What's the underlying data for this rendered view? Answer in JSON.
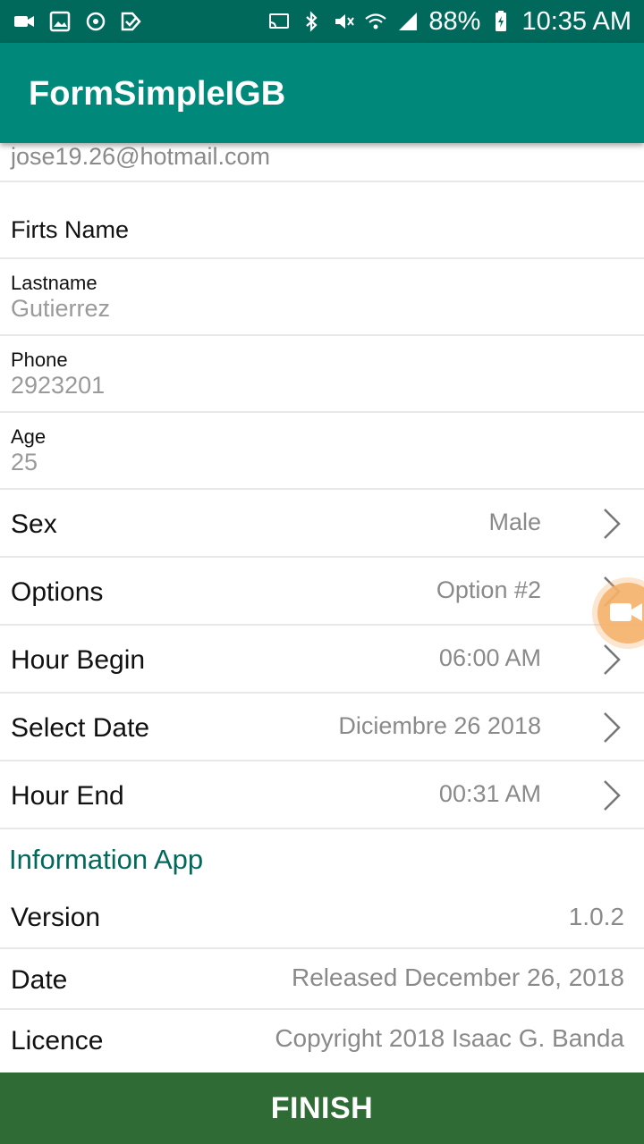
{
  "status_bar": {
    "battery": "88%",
    "time": "10:35 AM",
    "left_icons": [
      "video-icon",
      "image-icon",
      "sync-icon",
      "checkmark-icon"
    ],
    "right_icons": [
      "cast-icon",
      "bluetooth-icon",
      "mute-icon",
      "wifi-icon",
      "signal-icon",
      "battery-icon"
    ]
  },
  "app_bar": {
    "title": "FormSimpleIGB"
  },
  "form": {
    "email_value": "jose19.26@hotmail.com",
    "first_name_label": "Firts Name",
    "lastname": {
      "label": "Lastname",
      "value": "Gutierrez"
    },
    "phone": {
      "label": "Phone",
      "value": "2923201"
    },
    "age": {
      "label": "Age",
      "value": "25"
    },
    "sex": {
      "label": "Sex",
      "value": "Male"
    },
    "options": {
      "label": "Options",
      "value": "Option #2"
    },
    "hour_begin": {
      "label": "Hour Begin",
      "value": "06:00 AM"
    },
    "select_date": {
      "label": "Select Date",
      "value": "Diciembre 26 2018"
    },
    "hour_end": {
      "label": "Hour End",
      "value": "00:31 AM"
    }
  },
  "info": {
    "section_title": "Information App",
    "version": {
      "label": "Version",
      "value": "1.0.2"
    },
    "date": {
      "label": "Date",
      "value": "Released December 26, 2018"
    },
    "licence": {
      "label": "Licence",
      "value": "Copyright 2018 Isaac G. Banda"
    }
  },
  "footer": {
    "finish_label": "FINISH"
  },
  "colors": {
    "status_bar": "#00695c",
    "app_bar": "#00897b",
    "finish": "#2e6b35",
    "section": "#00695c"
  }
}
